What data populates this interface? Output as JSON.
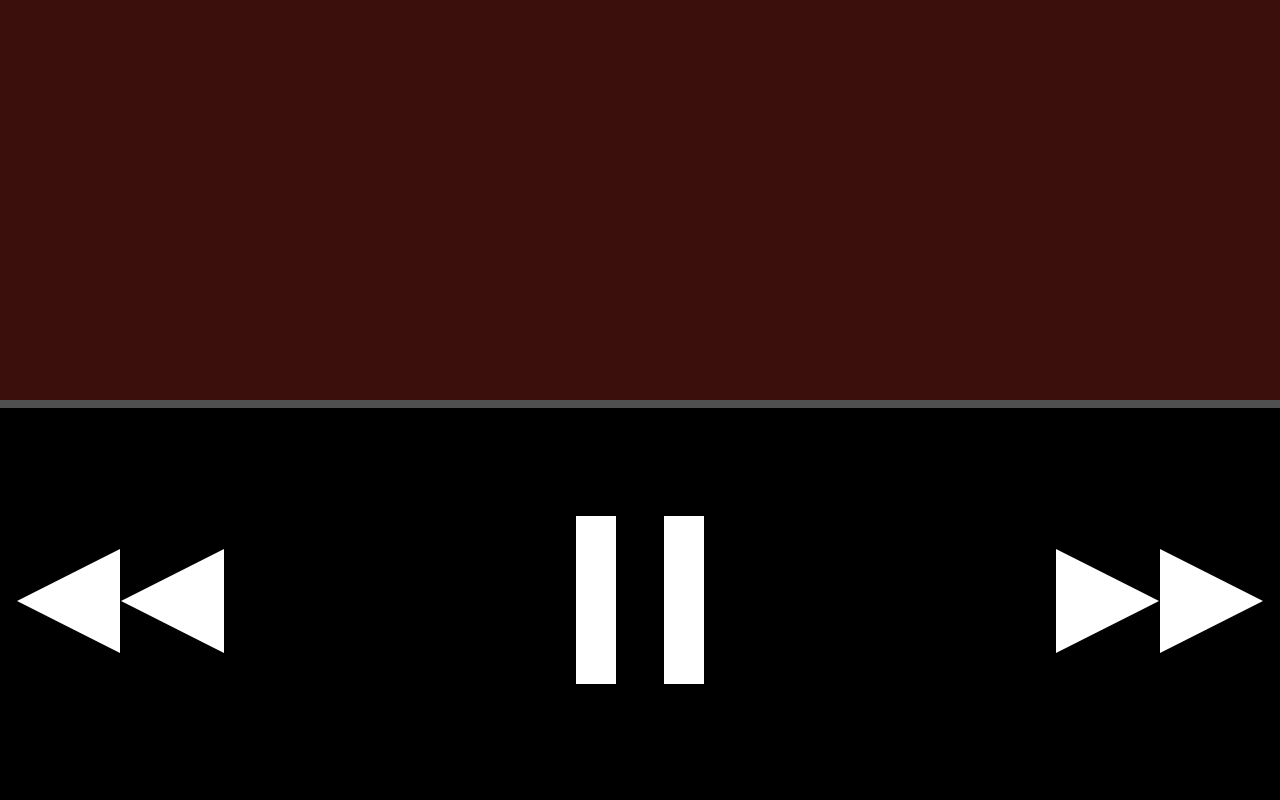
{
  "player": {
    "video_area": {
      "color": "#3b100c"
    },
    "divider": {
      "color": "#505050"
    },
    "controls": {
      "background": "#000000",
      "icon_color": "#ffffff",
      "buttons": [
        {
          "id": "rewind",
          "icon": "rewind-icon"
        },
        {
          "id": "pause",
          "icon": "pause-icon"
        },
        {
          "id": "fast-forward",
          "icon": "fast-forward-icon"
        }
      ]
    }
  }
}
